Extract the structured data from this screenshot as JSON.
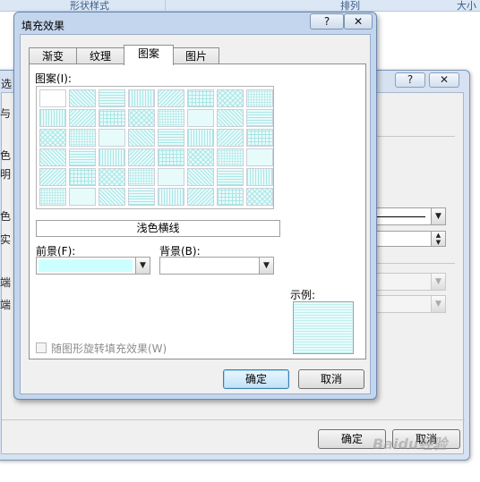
{
  "ribbon": {
    "group1": "形状样式",
    "group2": "排列",
    "group3": "大小"
  },
  "background_dialog": {
    "title_cut": "选",
    "help": "?",
    "close": "✕",
    "labels_cut": [
      "与",
      "色",
      "明",
      "色",
      "实",
      "端",
      "端"
    ],
    "ok_label": "确定",
    "cancel_label": "取消"
  },
  "dialog": {
    "title": "填充效果",
    "help": "?",
    "close": "✕",
    "tabs": [
      "渐变",
      "纹理",
      "图案",
      "图片"
    ],
    "active_tab": "图案",
    "pattern_label": "图案(I):",
    "selected_pattern_name": "浅色横线",
    "foreground_label": "前景(F):",
    "background_label": "背景(B):",
    "foreground_color": "#ccffff",
    "sample_label": "示例:",
    "rotate_checkbox_label": "随图形旋转填充效果(W)",
    "ok_label": "确定",
    "cancel_label": "取消"
  },
  "pattern_colors": {
    "line": "#a9e6e6",
    "fill": "#e8fbfb",
    "border": "#c8d0d8"
  },
  "watermark": "Baidu经验"
}
